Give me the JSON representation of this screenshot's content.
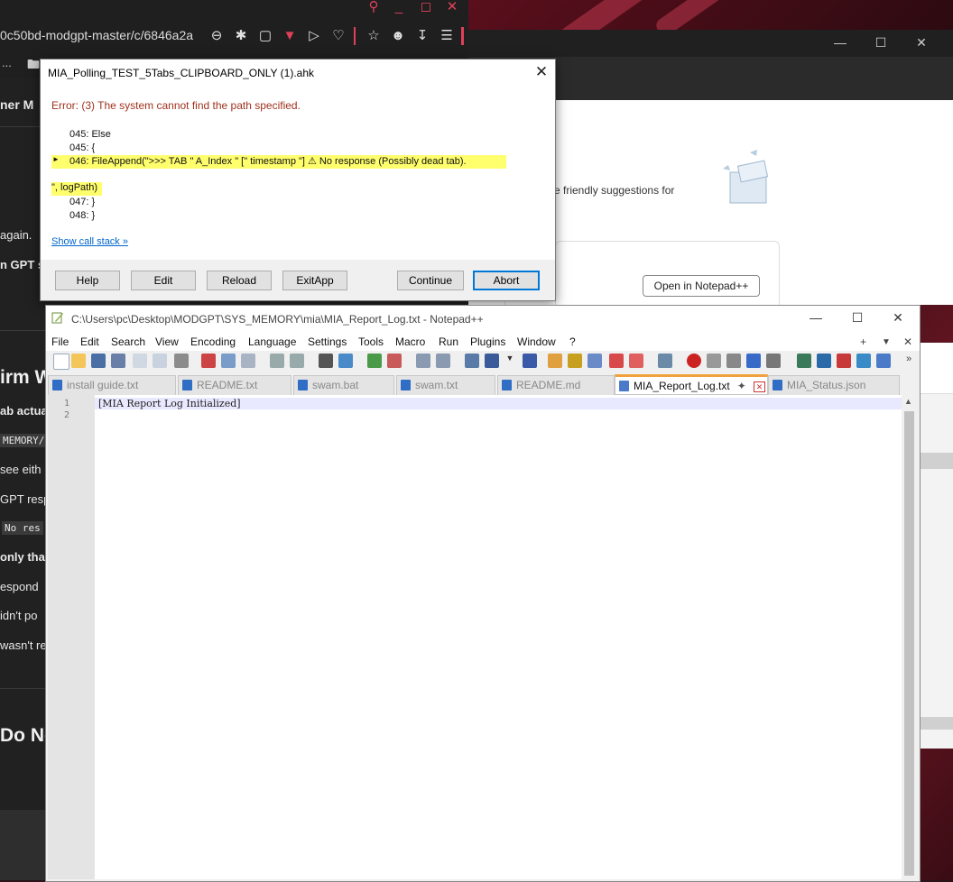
{
  "browser": {
    "url": "0c50bd-modgpt-master/c/6846a2a",
    "tab_overflow": "...",
    "chat": {
      "heading_partial": "ner M",
      "line_again": "again.",
      "line_gpt": "n GPT s",
      "heading_confirm": "irm W",
      "line_tab": "ab actua",
      "code_memory": "MEMORY/",
      "line_see": "see eith",
      "line_gpt_resp": "GPT resp",
      "code_no_resp": "No res",
      "line_only": "only tha",
      "line_respond": "espond",
      "line_didnt": "idn't po",
      "line_wasnt": "wasn't re",
      "heading_do": "Do Ne"
    }
  },
  "win2": {
    "suggestion_text": "me friendly suggestions for",
    "open_notepad_label": "Open in Notepad++"
  },
  "ahk_dialog": {
    "title": "MIA_Polling_TEST_5Tabs_CLIPBOARD_ONLY (1).ahk",
    "error": "Error: (3) The system cannot find the path specified.",
    "lines": {
      "l045a": "045: Else",
      "l045b": "045: {",
      "l046": "046: FileAppend(\">>> TAB \" A_Index \" [\" timestamp \"] ⚠   No response (Possibly dead tab).",
      "l046b": "\", logPath)",
      "l047": "047: }",
      "l048": "048: }"
    },
    "call_stack_link": "Show call stack »",
    "buttons": {
      "help": "Help",
      "edit": "Edit",
      "reload": "Reload",
      "exitapp": "ExitApp",
      "continue": "Continue",
      "abort": "Abort"
    }
  },
  "notepad": {
    "title": "C:\\Users\\pc\\Desktop\\MODGPT\\SYS_MEMORY\\mia\\MIA_Report_Log.txt - Notepad++",
    "menu": [
      "File",
      "Edit",
      "Search",
      "View",
      "Encoding",
      "Language",
      "Settings",
      "Tools",
      "Macro",
      "Run",
      "Plugins",
      "Window",
      "?"
    ],
    "tabs": [
      "install guide.txt",
      "README.txt",
      "swam.bat",
      "swam.txt",
      "README.md",
      "MIA_Report_Log.txt",
      "MIA_Status.json"
    ],
    "active_tab": "MIA_Report_Log.txt",
    "line_numbers": [
      "1",
      "2"
    ],
    "line1": "[MIA Report Log Initialized]",
    "accent_color": "#f1a23d"
  }
}
